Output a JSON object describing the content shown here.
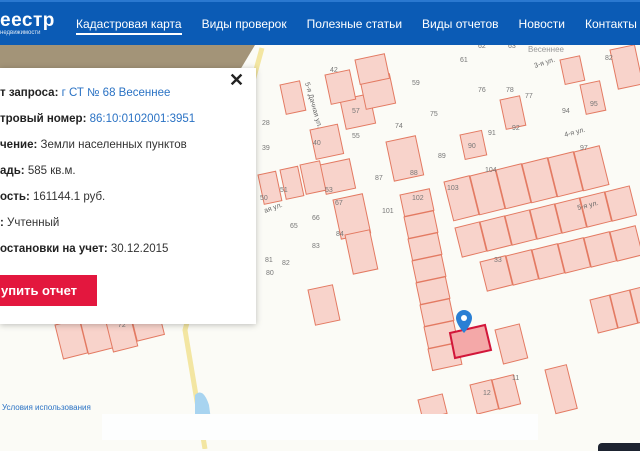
{
  "header": {
    "logo_title": "еестр",
    "logo_subtitle": "недвижимости",
    "menu": [
      {
        "label": "Кадастровая карта",
        "active": true
      },
      {
        "label": "Виды проверок"
      },
      {
        "label": "Полезные статьи"
      },
      {
        "label": "Виды отчетов"
      },
      {
        "label": "Новости"
      },
      {
        "label": "Контакты"
      }
    ]
  },
  "popup": {
    "rows": [
      {
        "label": "т запроса:",
        "value": "г СТ № 68 Весеннее",
        "link": true
      },
      {
        "label": "тровый номер:",
        "value": "86:10:0102001:3951",
        "link": true
      },
      {
        "label": "чение:",
        "value": "Земли населенных пунктов"
      },
      {
        "label": "адь:",
        "value": "585 кв.м."
      },
      {
        "label": "ость:",
        "value": "161144.1 руб."
      },
      {
        "label": ":",
        "value": "Учтенный"
      },
      {
        "label": "остановки на учет:",
        "value": "30.12.2015"
      }
    ],
    "buy_label": "упить отчет",
    "close_icon": "close-icon"
  },
  "map": {
    "terms_label": "Условия использования",
    "streets": [
      "Весеннее",
      "5-я Дачная ул.",
      "3-я ул.",
      "4-я ул.",
      "5-я ул.",
      "ая ул."
    ],
    "parcel_labels": [
      "62",
      "63",
      "42",
      "59",
      "61",
      "78",
      "76",
      "77",
      "82",
      "28",
      "57",
      "95",
      "39",
      "40",
      "55",
      "75",
      "91",
      "92",
      "94",
      "89",
      "90",
      "97",
      "74",
      "87",
      "88",
      "103",
      "104",
      "51",
      "50",
      "53",
      "67",
      "102",
      "66",
      "101",
      "65",
      "33",
      "83",
      "84",
      "82",
      "81",
      "80",
      "72",
      "12",
      "11"
    ],
    "colors": {
      "parcel_fill": "#f8d3cb",
      "parcel_stroke": "#e37a62",
      "selected_stroke": "#d2163a",
      "marker": "#2a7fd4",
      "road": "#f5e7a0"
    }
  }
}
